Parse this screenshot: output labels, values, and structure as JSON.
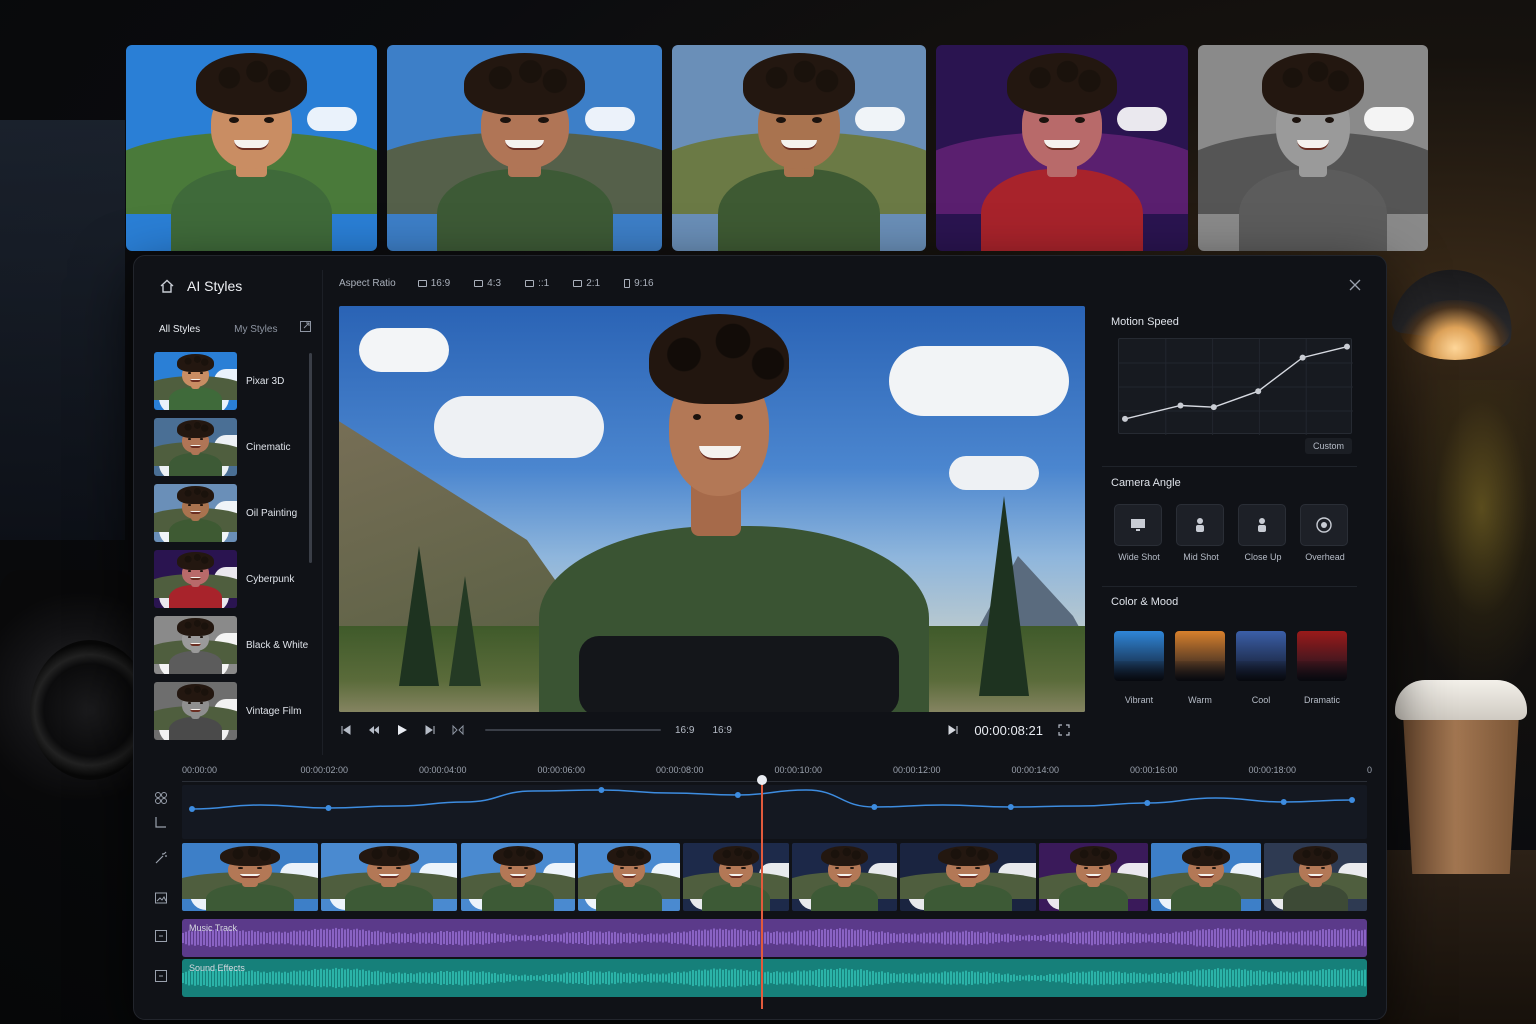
{
  "top_styles": [
    {
      "name": "pixar-3d",
      "sky": "#2a7fd6",
      "hill": "#4a7a3a",
      "hoodie": "#3f6a3a",
      "skin": "#c98d63"
    },
    {
      "name": "cinematic",
      "sky": "#3d7fc8",
      "hill": "#55604a",
      "hoodie": "#3d5a36",
      "skin": "#b07556"
    },
    {
      "name": "oil-painting",
      "sky": "#6a8fb8",
      "hill": "#6b7a45",
      "hoodie": "#3e5a33",
      "skin": "#a9734f"
    },
    {
      "name": "cyberpunk",
      "sky": "#2a1450",
      "hill": "#5a1f6f",
      "hoodie": "#a8232b",
      "skin": "#b86a6a"
    },
    {
      "name": "black-white",
      "sky": "#8a8a8a",
      "hill": "#555555",
      "hoodie": "#5c5c5c",
      "skin": "#9a9a9a"
    }
  ],
  "app": {
    "title": "AI Styles"
  },
  "toolbar": {
    "aspect_label": "Aspect Ratio",
    "options": [
      "16:9",
      "4:3",
      "::1",
      "2:1",
      "9:16"
    ]
  },
  "left_panel": {
    "tabs": [
      "All Styles",
      "My Styles"
    ],
    "styles": [
      {
        "label": "Pixar 3D",
        "sky": "#2a7fd6",
        "hoodie": "#3f6a3a",
        "skin": "#c98d63"
      },
      {
        "label": "Cinematic",
        "sky": "#4a6f95",
        "hoodie": "#3d5a36",
        "skin": "#b07556"
      },
      {
        "label": "Oil Painting",
        "sky": "#6a8fb8",
        "hoodie": "#3e5a33",
        "skin": "#a9734f"
      },
      {
        "label": "Cyberpunk",
        "sky": "#2a1450",
        "hoodie": "#a8232b",
        "skin": "#b86a6a"
      },
      {
        "label": "Black & White",
        "sky": "#8a8a8a",
        "hoodie": "#5c5c5c",
        "skin": "#9a9a9a"
      },
      {
        "label": "Vintage Film",
        "sky": "#6e6e6e",
        "hoodie": "#4a4a4a",
        "skin": "#8f8f8f"
      }
    ]
  },
  "player": {
    "ratio_a": "16:9",
    "ratio_b": "16:9",
    "timecode": "00:00:08:21"
  },
  "right_panel": {
    "motion_speed": {
      "title": "Motion Speed",
      "points": [
        [
          0.0,
          0.12
        ],
        [
          0.25,
          0.28
        ],
        [
          0.4,
          0.26
        ],
        [
          0.6,
          0.45
        ],
        [
          0.8,
          0.85
        ],
        [
          1.0,
          0.98
        ]
      ],
      "button": "Custom"
    },
    "camera_angle": {
      "title": "Camera Angle",
      "options": [
        "Wide Shot",
        "Mid Shot",
        "Close Up",
        "Overhead"
      ]
    },
    "color_mood": {
      "title": "Color & Mood",
      "options": [
        {
          "label": "Vibrant",
          "color": "#2f86d8"
        },
        {
          "label": "Warm",
          "color": "#d8802c"
        },
        {
          "label": "Cool",
          "color": "#3b5fa8"
        },
        {
          "label": "Dramatic",
          "color": "#9a1a1a"
        }
      ]
    }
  },
  "timeline": {
    "ticks": [
      "00:00:00",
      "00:00:02:00",
      "00:00:04:00",
      "00:00:06:00",
      "00:00:08:00",
      "00:00:10:00",
      "00:00:12:00",
      "00:00:14:00",
      "00:00:16:00",
      "00:00:18:00",
      "0"
    ],
    "clips": [
      {
        "sky": "#3d7fc8",
        "hoodie": "#3d5a36"
      },
      {
        "sky": "#4a8ad0",
        "hoodie": "#3d5a36"
      },
      {
        "sky": "#4a8ad0",
        "hoodie": "#3d5a36"
      },
      {
        "sky": "#4a8ad0",
        "hoodie": "#3d5a36"
      },
      {
        "sky": "#1d2a4a",
        "hoodie": "#3d5a36"
      },
      {
        "sky": "#1c2848",
        "hoodie": "#3d5a36"
      },
      {
        "sky": "#1a2440",
        "hoodie": "#3d5a36"
      },
      {
        "sky": "#3a1a5a",
        "hoodie": "#3d5a36"
      },
      {
        "sky": "#3d7fc8",
        "hoodie": "#3d5a36"
      },
      {
        "sky": "#2e3a52",
        "hoodie": "#3d4a36"
      }
    ],
    "music_track": "Music Track",
    "sound_effects": "Sound Effects",
    "music_color": "#5b3a8a",
    "sfx_color": "#16807a"
  }
}
